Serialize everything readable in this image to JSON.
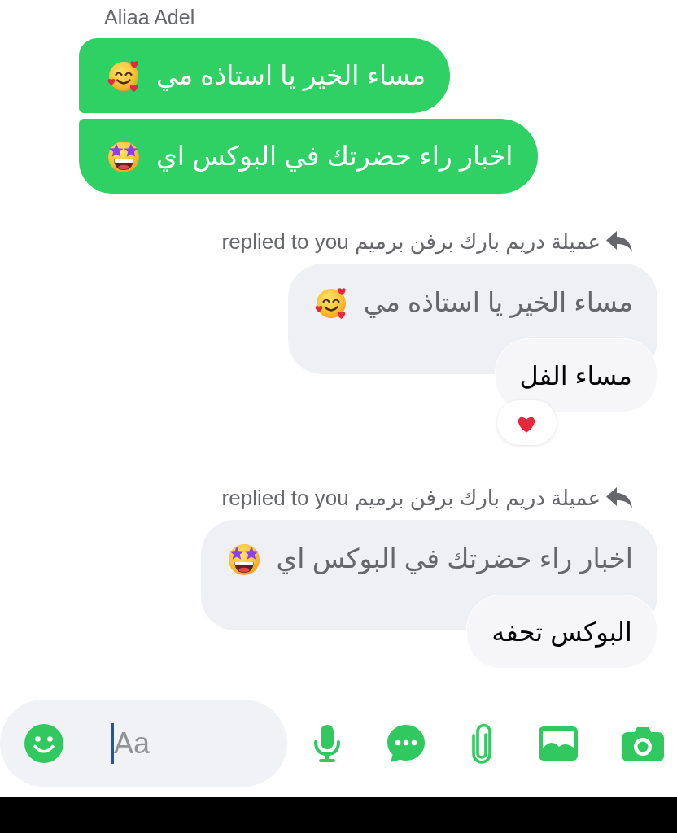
{
  "sender_name": "Aliaa Adel",
  "incoming_messages": [
    {
      "text": "مساء الخير يا استاذه مي",
      "emoji": {
        "kind": "hearts"
      }
    },
    {
      "text": "اخبار راء حضرتك في البوكس اي",
      "emoji": {
        "kind": "starstruck"
      }
    }
  ],
  "replies": [
    {
      "reply_note": "عميلة دريم بارك برفن برميم replied to you",
      "quoted": {
        "text": "مساء الخير يا استاذه مي",
        "emoji": {
          "kind": "hearts"
        }
      },
      "text": "مساء الفل",
      "reaction": {
        "kind": "heart"
      }
    },
    {
      "reply_note": "عميلة دريم بارك برفن برميم replied to you",
      "quoted": {
        "text": "اخبار راء حضرتك في البوكس اي",
        "emoji": {
          "kind": "starstruck"
        }
      },
      "text": "البوكس تحفه"
    }
  ],
  "composer": {
    "placeholder": "Aa",
    "focused": true
  }
}
